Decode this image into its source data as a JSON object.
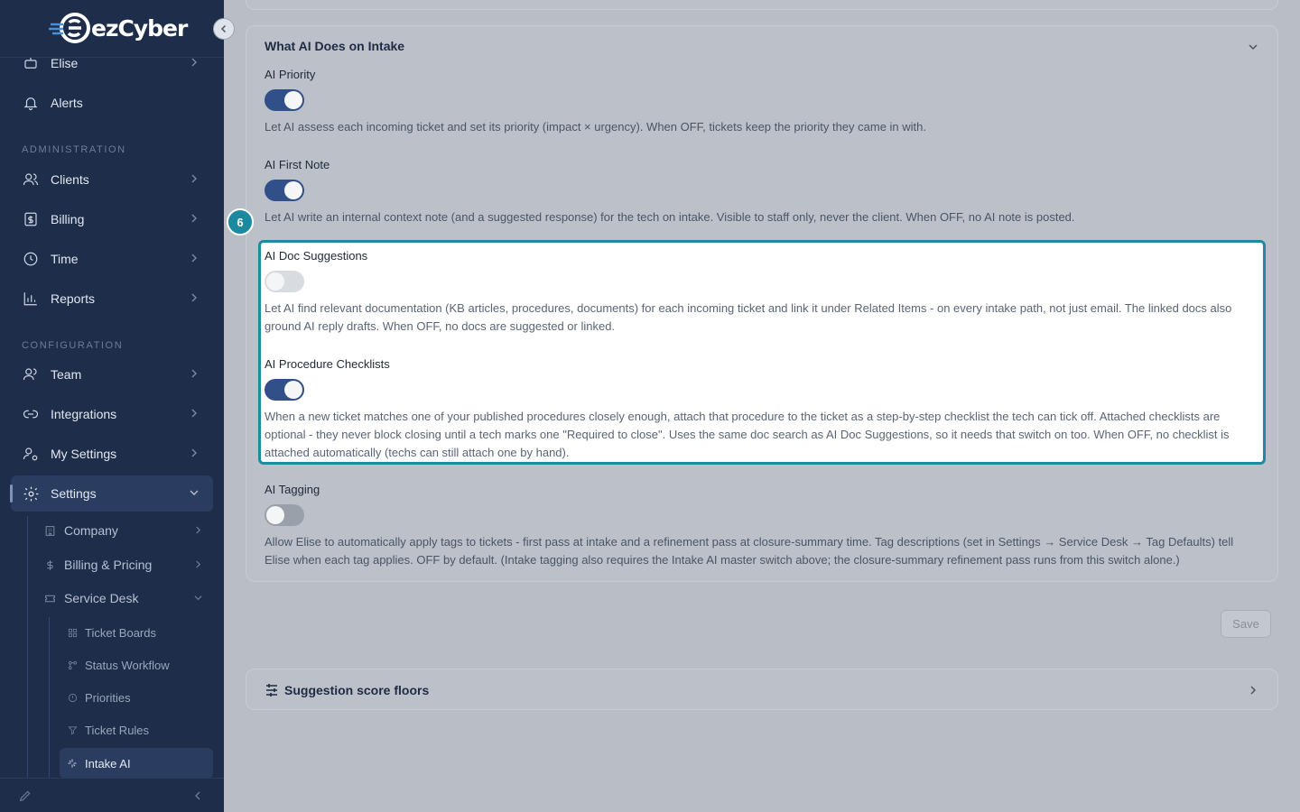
{
  "brand": {
    "logo_text": "ezCyber"
  },
  "sidebar": {
    "top_items": [
      {
        "label": "Elise",
        "icon": "robot-icon"
      },
      {
        "label": "Alerts",
        "icon": "bell-icon"
      }
    ],
    "administration_label": "ADMINISTRATION",
    "admin_items": [
      {
        "label": "Clients",
        "icon": "users-icon"
      },
      {
        "label": "Billing",
        "icon": "dollar-doc-icon"
      },
      {
        "label": "Time",
        "icon": "clock-icon"
      },
      {
        "label": "Reports",
        "icon": "bar-chart-icon"
      }
    ],
    "configuration_label": "CONFIGURATION",
    "config_items": [
      {
        "label": "Team",
        "icon": "team-icon"
      },
      {
        "label": "Integrations",
        "icon": "link-icon"
      },
      {
        "label": "My Settings",
        "icon": "user-gear-icon"
      },
      {
        "label": "Settings",
        "icon": "gear-icon"
      }
    ],
    "settings_sub": [
      {
        "label": "Company",
        "icon": "building-icon"
      },
      {
        "label": "Billing & Pricing",
        "icon": "dollar-icon"
      },
      {
        "label": "Service Desk",
        "icon": "ticket-icon"
      }
    ],
    "service_desk_sub": [
      {
        "label": "Ticket Boards",
        "icon": "grid-icon"
      },
      {
        "label": "Status Workflow",
        "icon": "workflow-icon"
      },
      {
        "label": "Priorities",
        "icon": "alert-circle-icon"
      },
      {
        "label": "Ticket Rules",
        "icon": "filter-icon"
      },
      {
        "label": "Intake AI",
        "icon": "sparkle-icon"
      }
    ]
  },
  "intake": {
    "title": "What AI Does on Intake",
    "settings": [
      {
        "label": "AI Priority",
        "enabled": true,
        "description": "Let AI assess each incoming ticket and set its priority (impact × urgency). When OFF, tickets keep the priority they came in with."
      },
      {
        "label": "AI First Note",
        "enabled": true,
        "description": "Let AI write an internal context note (and a suggested response) for the tech on intake. Visible to staff only, never the client. When OFF, no AI note is posted."
      },
      {
        "label": "AI Doc Suggestions",
        "enabled": false,
        "description": "Let AI find relevant documentation (KB articles, procedures, documents) for each incoming ticket and link it under Related Items - on every intake path, not just email. The linked docs also ground AI reply drafts. When OFF, no docs are suggested or linked."
      },
      {
        "label": "AI Procedure Checklists",
        "enabled": true,
        "description": "When a new ticket matches one of your published procedures closely enough, attach that procedure to the ticket as a step-by-step checklist the tech can tick off. Attached checklists are optional - they never block closing until a tech marks one \"Required to close\". Uses the same doc search as AI Doc Suggestions, so it needs that switch on too. When OFF, no checklist is attached automatically (techs can still attach one by hand)."
      },
      {
        "label": "AI Tagging",
        "enabled": false,
        "description": "Allow Elise to automatically apply tags to tickets - first pass at intake and a refinement pass at closure-summary time. Tag descriptions (set in Settings → Service Desk → Tag Defaults) tell Elise when each tag applies. OFF by default. (Intake tagging also requires the Intake AI master switch above; the closure-summary refinement pass runs from this switch alone.)"
      }
    ]
  },
  "tour": {
    "step_number": "6"
  },
  "actions": {
    "save_label": "Save"
  },
  "floors": {
    "title": "Suggestion score floors"
  },
  "colors": {
    "accent": "#1e8aa0",
    "toggle_on": "#31508a",
    "sidebar_bg": "#1d2d4a"
  }
}
